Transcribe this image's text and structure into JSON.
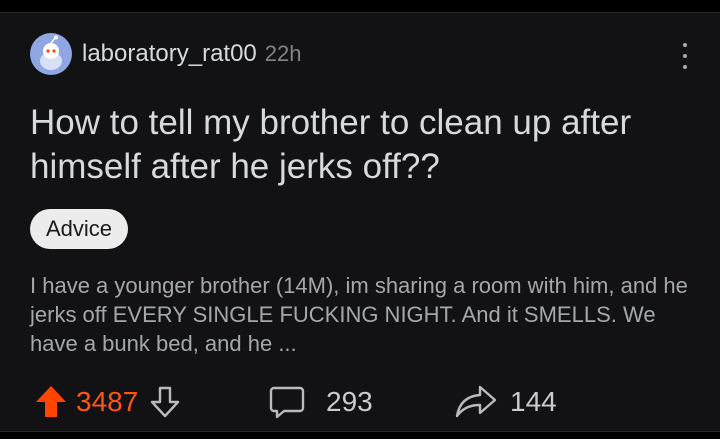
{
  "post": {
    "username": "laboratory_rat00",
    "timestamp": "22h",
    "title": "How to tell my brother to clean up after himself after he jerks off??",
    "flair": "Advice",
    "body": "I have a younger brother (14M), im sharing a room with him, and he jerks off EVERY SINGLE FUCKING NIGHT.  And it SMELLS. We have a bunk bed, and he ...",
    "votes": "3487",
    "comments": "293",
    "shares": "144"
  },
  "colors": {
    "background": "#121214",
    "upvote": "#ff4500",
    "avatar": "#8fa6e3",
    "text": "#d7dadc",
    "muted": "#818384"
  },
  "icons": {
    "avatar": "reddit-snoo-avatar",
    "menu": "more-vertical-icon",
    "upvote": "arrow-up-icon",
    "downvote": "arrow-down-icon",
    "comments": "speech-bubble-icon",
    "share": "share-arrow-icon"
  }
}
